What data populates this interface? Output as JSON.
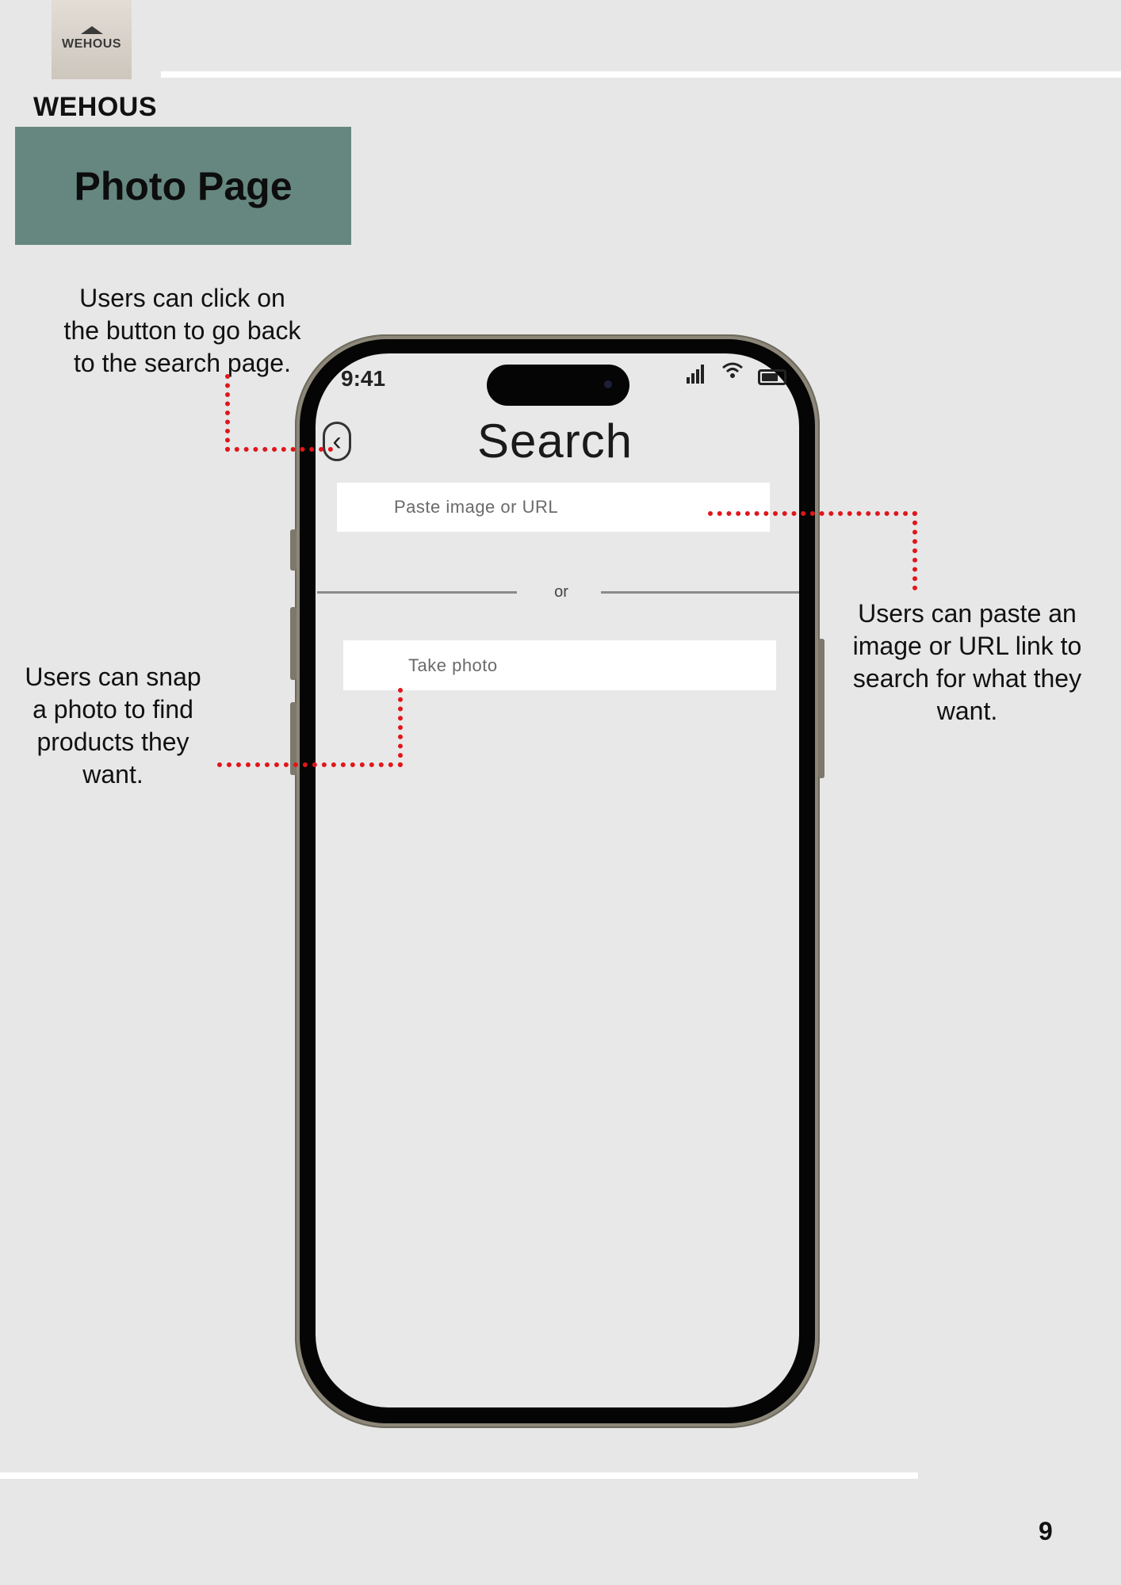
{
  "header": {
    "logo_text": "WEHOUS",
    "brand": "WEHOUS",
    "title": "Photo Page"
  },
  "annotations": {
    "back": "Users can click on the button to go back to the search page.",
    "paste": "Users can paste an image or URL link to search for what they want.",
    "photo": "Users can snap a photo to find products they want."
  },
  "phone": {
    "status_time": "9:41",
    "screen_title": "Search",
    "back_icon": "chevron-left-icon",
    "paste_placeholder": "Paste image or URL",
    "divider_text": "or",
    "photo_placeholder": "Take photo"
  },
  "colors": {
    "background": "#e7e7e7",
    "title_box": "#66877f",
    "annotation_line": "#e0161b"
  },
  "footer": {
    "page_number": "9"
  }
}
